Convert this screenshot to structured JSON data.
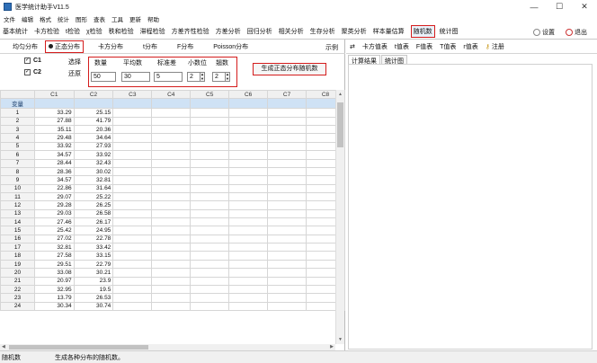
{
  "window": {
    "title": "医学统计助手V11.5",
    "controls": [
      "—",
      "☐",
      "✕"
    ]
  },
  "menu": [
    "文件",
    "编辑",
    "格式",
    "统计",
    "图形",
    "查表",
    "工具",
    "更新",
    "帮助"
  ],
  "tabs": [
    "基本统计",
    "卡方检验",
    "t检验",
    "χ检验",
    "秩和检验",
    "滞程检验",
    "方差齐性检验",
    "方差分析",
    "回归分析",
    "相关分析",
    "生存分析",
    "聚类分析",
    "样本量估算",
    "随机数",
    "统计图"
  ],
  "tab_active": "随机数",
  "tab_right": {
    "settings": "设置",
    "exit": "退出"
  },
  "dist_tabs": [
    "均匀分布",
    "正态分布",
    "卡方分布",
    "t分布",
    "F分布",
    "Poisson分布"
  ],
  "dist_active": "正态分布",
  "example_label": "示例",
  "params": {
    "c1": "C1",
    "c2": "C2",
    "select_label": "选择",
    "restore_label": "还原",
    "headers": [
      "数量",
      "平均数",
      "标准差",
      "小数位",
      "翘数"
    ],
    "values": {
      "count": "50",
      "mean": "30",
      "sd": "5",
      "decimals": "2",
      "seed": "2"
    },
    "generate_button": "生成正态分布随机数"
  },
  "grid": {
    "columns": [
      "C1",
      "C2",
      "C3",
      "C4",
      "C5",
      "C6",
      "C7",
      "C8"
    ],
    "label_row": "变量",
    "rows": [
      [
        "1",
        "33.29",
        "25.15"
      ],
      [
        "2",
        "27.88",
        "41.79"
      ],
      [
        "3",
        "35.11",
        "20.36"
      ],
      [
        "4",
        "29.48",
        "34.64"
      ],
      [
        "5",
        "33.92",
        "27.93"
      ],
      [
        "6",
        "34.57",
        "33.92"
      ],
      [
        "7",
        "28.44",
        "32.43"
      ],
      [
        "8",
        "28.36",
        "30.02"
      ],
      [
        "9",
        "34.57",
        "32.81"
      ],
      [
        "10",
        "22.86",
        "31.64"
      ],
      [
        "11",
        "29.07",
        "25.22"
      ],
      [
        "12",
        "29.28",
        "26.25"
      ],
      [
        "13",
        "29.03",
        "26.58"
      ],
      [
        "14",
        "27.46",
        "26.17"
      ],
      [
        "15",
        "25.42",
        "24.95"
      ],
      [
        "16",
        "27.02",
        "22.78"
      ],
      [
        "17",
        "32.81",
        "33.42"
      ],
      [
        "18",
        "27.58",
        "33.15"
      ],
      [
        "19",
        "29.51",
        "22.79"
      ],
      [
        "20",
        "33.08",
        "30.21"
      ],
      [
        "21",
        "20.97",
        "23.9"
      ],
      [
        "22",
        "32.95",
        "19.5"
      ],
      [
        "23",
        "13.79",
        "26.53"
      ],
      [
        "24",
        "30.34",
        "30.74"
      ]
    ]
  },
  "right_tools": [
    "卡方值表",
    "t值表",
    "F值表",
    "T值表",
    "r值表",
    "注册"
  ],
  "right_tabs": [
    "计算结果",
    "统计图"
  ],
  "status": {
    "left": "随机数",
    "right": "生成各种分布的随机数。"
  }
}
